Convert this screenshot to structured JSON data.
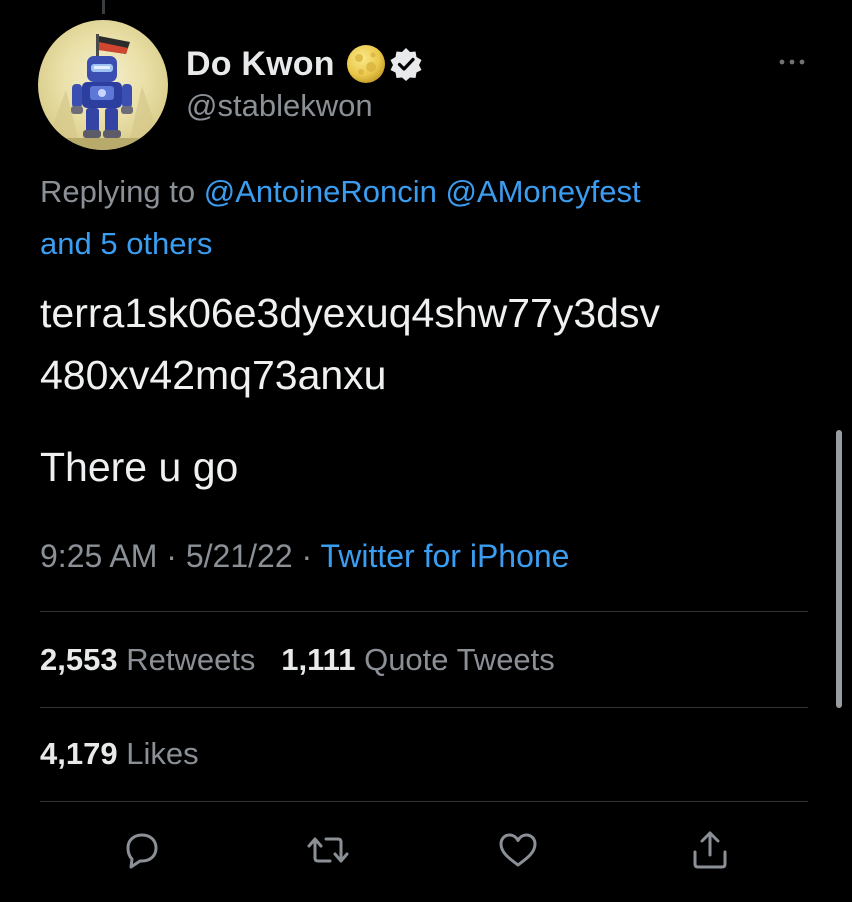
{
  "tweet": {
    "author": {
      "display_name": "Do Kwon",
      "handle": "@stablekwon",
      "avatar_icon": "robot-avatar",
      "badges": [
        "moon-emoji",
        "verified-badge"
      ]
    },
    "reply_context": {
      "prefix": "Replying to",
      "mentions": [
        "@AntoineRoncin",
        "@AMoneyfest"
      ],
      "others": "and 5 others"
    },
    "text_lines": [
      "terra1sk06e3dyexuq4shw77y3dsv",
      "480xv42mq73anxu"
    ],
    "text_second_paragraph": "There u go",
    "timestamp": "9:25 AM",
    "date": "5/21/22",
    "separator": "·",
    "source": "Twitter for iPhone",
    "stats": {
      "retweets_count": "2,553",
      "retweets_label": "Retweets",
      "quotes_count": "1,111",
      "quotes_label": "Quote Tweets",
      "likes_count": "4,179",
      "likes_label": "Likes"
    },
    "actions": [
      "reply-icon",
      "retweet-icon",
      "like-icon",
      "share-icon"
    ]
  },
  "colors": {
    "background": "#000000",
    "text_primary": "#e7e9ea",
    "text_secondary": "#8b9096",
    "link": "#3b9df0",
    "divider": "#2f3336"
  }
}
